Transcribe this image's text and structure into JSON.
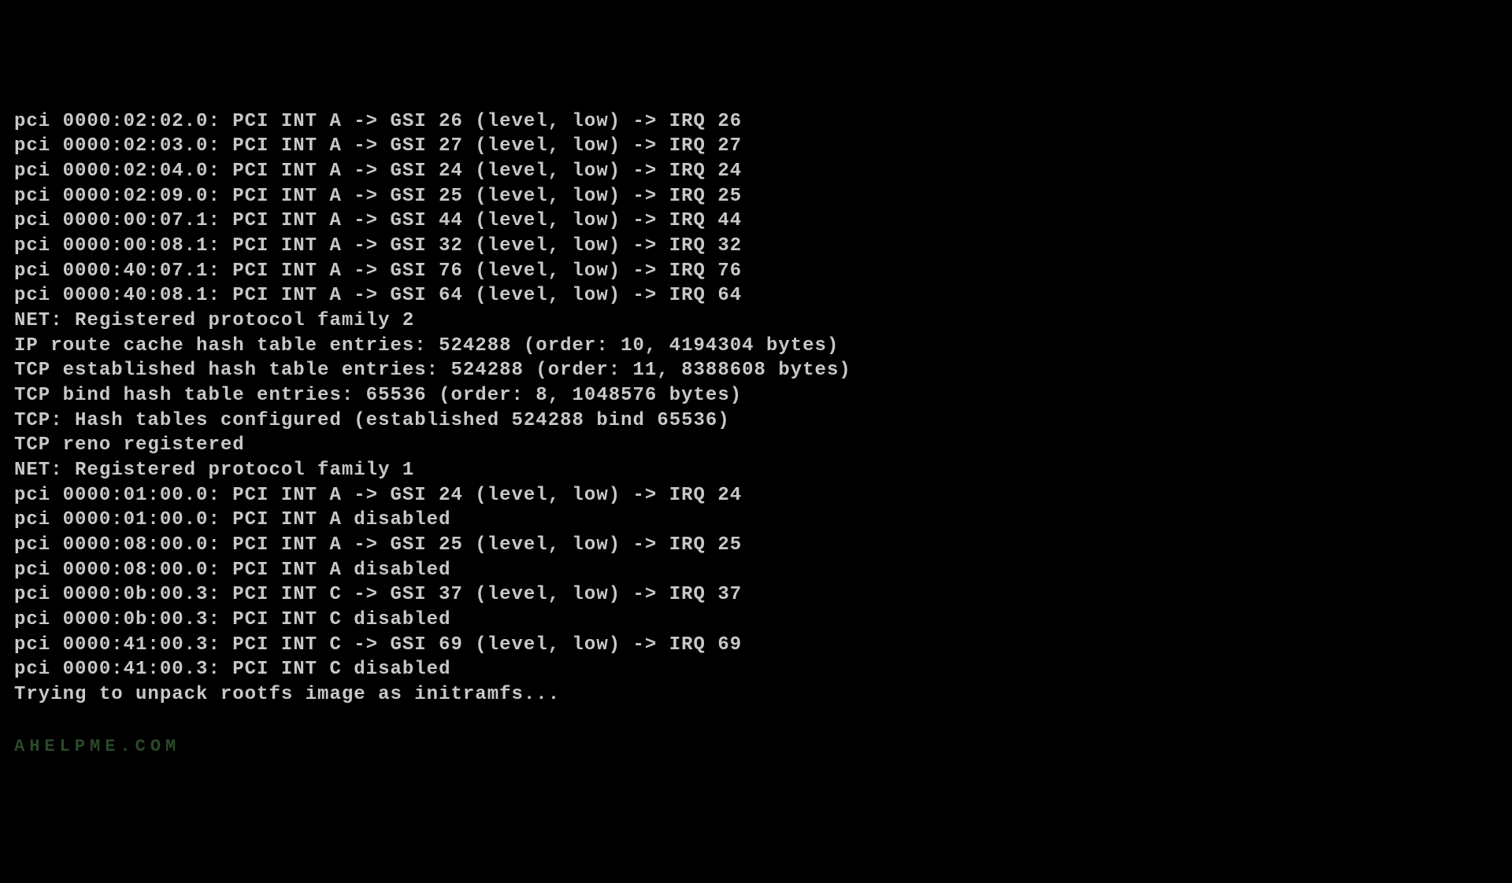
{
  "console": {
    "lines": [
      "pci 0000:02:02.0: PCI INT A -> GSI 26 (level, low) -> IRQ 26",
      "pci 0000:02:03.0: PCI INT A -> GSI 27 (level, low) -> IRQ 27",
      "pci 0000:02:04.0: PCI INT A -> GSI 24 (level, low) -> IRQ 24",
      "pci 0000:02:09.0: PCI INT A -> GSI 25 (level, low) -> IRQ 25",
      "pci 0000:00:07.1: PCI INT A -> GSI 44 (level, low) -> IRQ 44",
      "pci 0000:00:08.1: PCI INT A -> GSI 32 (level, low) -> IRQ 32",
      "pci 0000:40:07.1: PCI INT A -> GSI 76 (level, low) -> IRQ 76",
      "pci 0000:40:08.1: PCI INT A -> GSI 64 (level, low) -> IRQ 64",
      "NET: Registered protocol family 2",
      "IP route cache hash table entries: 524288 (order: 10, 4194304 bytes)",
      "TCP established hash table entries: 524288 (order: 11, 8388608 bytes)",
      "TCP bind hash table entries: 65536 (order: 8, 1048576 bytes)",
      "TCP: Hash tables configured (established 524288 bind 65536)",
      "TCP reno registered",
      "NET: Registered protocol family 1",
      "pci 0000:01:00.0: PCI INT A -> GSI 24 (level, low) -> IRQ 24",
      "pci 0000:01:00.0: PCI INT A disabled",
      "pci 0000:08:00.0: PCI INT A -> GSI 25 (level, low) -> IRQ 25",
      "pci 0000:08:00.0: PCI INT A disabled",
      "pci 0000:0b:00.3: PCI INT C -> GSI 37 (level, low) -> IRQ 37",
      "pci 0000:0b:00.3: PCI INT C disabled",
      "pci 0000:41:00.3: PCI INT C -> GSI 69 (level, low) -> IRQ 69",
      "pci 0000:41:00.3: PCI INT C disabled",
      "Trying to unpack rootfs image as initramfs..."
    ],
    "watermark": "AHELPME.COM"
  }
}
